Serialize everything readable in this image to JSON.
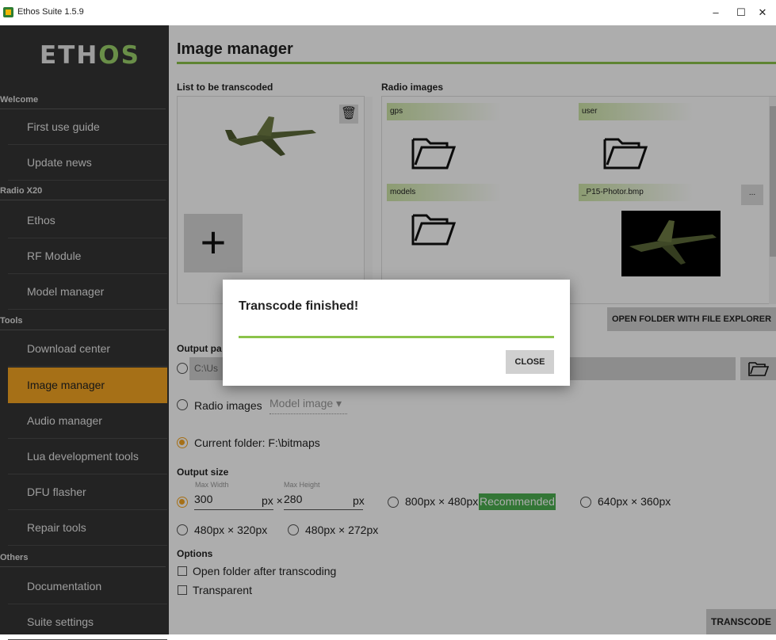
{
  "window": {
    "title": "Ethos Suite 1.5.9",
    "minimize": "–",
    "maximize": "☐",
    "close": "✕"
  },
  "sidebar": {
    "logo_main": "ETH",
    "logo_accent": "OS",
    "sections": [
      {
        "label": "Welcome"
      },
      {
        "label": "Radio X20"
      },
      {
        "label": "Tools"
      },
      {
        "label": "Others"
      }
    ],
    "items": [
      {
        "label": "First use guide"
      },
      {
        "label": "Update news"
      },
      {
        "label": "Ethos"
      },
      {
        "label": "RF Module"
      },
      {
        "label": "Model manager"
      },
      {
        "label": "Download center"
      },
      {
        "label": "Image manager"
      },
      {
        "label": "Audio manager"
      },
      {
        "label": "Lua development tools"
      },
      {
        "label": "DFU flasher"
      },
      {
        "label": "Repair tools"
      },
      {
        "label": "Documentation"
      },
      {
        "label": "Suite settings"
      }
    ],
    "active": "Image manager"
  },
  "main": {
    "title": "Image manager",
    "list_label": "List to be transcoded",
    "radio_label": "Radio images",
    "radio_items": [
      {
        "name": "gps",
        "type": "folder"
      },
      {
        "name": "user",
        "type": "folder"
      },
      {
        "name": "models",
        "type": "folder"
      },
      {
        "name": "_P15-Photor.bmp",
        "type": "image"
      }
    ],
    "dots_label": "...",
    "open_folder_label": "OPEN FOLDER WITH FILE EXPLORER",
    "output_path_label": "Output pa",
    "output_path_value": "C:\\Us",
    "radio_images_option": "Radio images",
    "model_image_select": "Model image",
    "current_folder_option": "Current folder: F:\\bitmaps",
    "output_size_label": "Output size",
    "max_width_label": "Max Width",
    "max_height_label": "Max Height",
    "width_value": "300",
    "height_value": "280",
    "px_x": "px ×",
    "px": "px",
    "size_800": "800px × 480px",
    "recommended": "Recommended",
    "size_640": "640px × 360px",
    "size_480_320": "480px × 320px",
    "size_480_272": "480px × 272px",
    "options_label": "Options",
    "open_after": "Open folder after transcoding",
    "transparent": "Transparent",
    "transcode_label": "TRANSCODE"
  },
  "dialog": {
    "title": "Transcode finished!",
    "progress": 1.0,
    "close_label": "CLOSE"
  },
  "colors": {
    "accent": "#f5a623",
    "green": "#8bc34a",
    "recommended": "#4caf50",
    "sidebar": "#343434"
  }
}
